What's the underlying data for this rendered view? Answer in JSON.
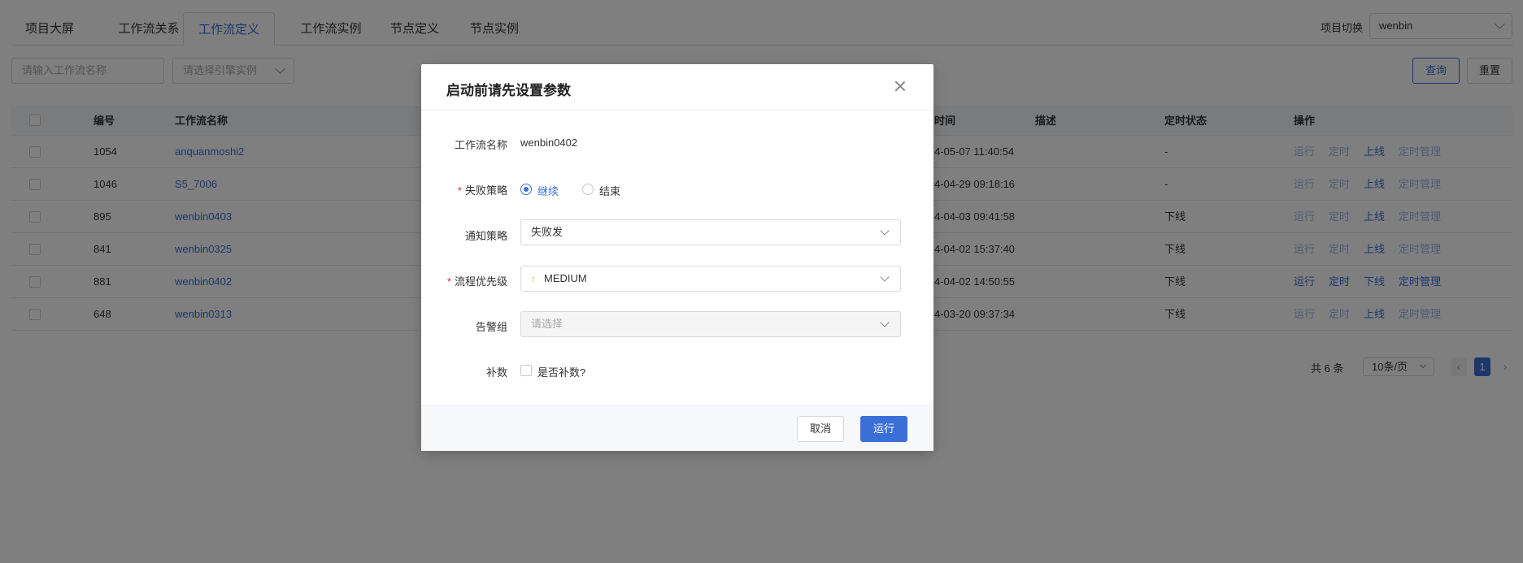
{
  "tabs": [
    {
      "label": "项目大屏"
    },
    {
      "label": "工作流关系"
    },
    {
      "label": "工作流定义"
    },
    {
      "label": "工作流实例"
    },
    {
      "label": "节点定义"
    },
    {
      "label": "节点实例"
    }
  ],
  "project_switch": {
    "label": "项目切换",
    "value": "wenbin"
  },
  "filters": {
    "name_placeholder": "请输入工作流名称",
    "engine_placeholder": "请选择引擎实例",
    "query_label": "查询",
    "reset_label": "重置"
  },
  "table": {
    "headers": {
      "id": "编号",
      "name": "工作流名称",
      "time": "时间",
      "desc": "描述",
      "schedule_status": "定时状态",
      "actions": "操作"
    },
    "rows": [
      {
        "id": "1054",
        "name": "anquanmoshi2",
        "time": "4-05-07 11:40:54",
        "status": "-",
        "enabled": false
      },
      {
        "id": "1046",
        "name": "S5_7006",
        "time": "4-04-29 09:18:16",
        "status": "-",
        "enabled": false
      },
      {
        "id": "895",
        "name": "wenbin0403",
        "time": "4-04-03 09:41:58",
        "status": "下线",
        "enabled": false
      },
      {
        "id": "841",
        "name": "wenbin0325",
        "time": "4-04-02 15:37:40",
        "status": "下线",
        "enabled": false
      },
      {
        "id": "881",
        "name": "wenbin0402",
        "time": "4-04-02 14:50:55",
        "status": "下线",
        "enabled": true
      },
      {
        "id": "648",
        "name": "wenbin0313",
        "time": "4-03-20 09:37:34",
        "status": "下线",
        "enabled": false
      }
    ],
    "actions": {
      "run": "运行",
      "schedule": "定时",
      "online": "上线",
      "offline": "下线",
      "manage": "定时管理"
    }
  },
  "pagination": {
    "total": "共 6 条",
    "page_size": "10条/页",
    "current": "1"
  },
  "modal": {
    "title": "启动前请先设置参数",
    "fields": {
      "name_label": "工作流名称",
      "name_value": "wenbin0402",
      "failure_label": "失败策略",
      "failure_options": [
        "继续",
        "结束"
      ],
      "notify_label": "通知策略",
      "notify_value": "失败发",
      "priority_label": "流程优先级",
      "priority_value": "MEDIUM",
      "alert_label": "告警组",
      "alert_placeholder": "请选择",
      "backfill_label": "补数",
      "backfill_text": "是否补数?"
    },
    "cancel_label": "取消",
    "run_label": "运行"
  }
}
